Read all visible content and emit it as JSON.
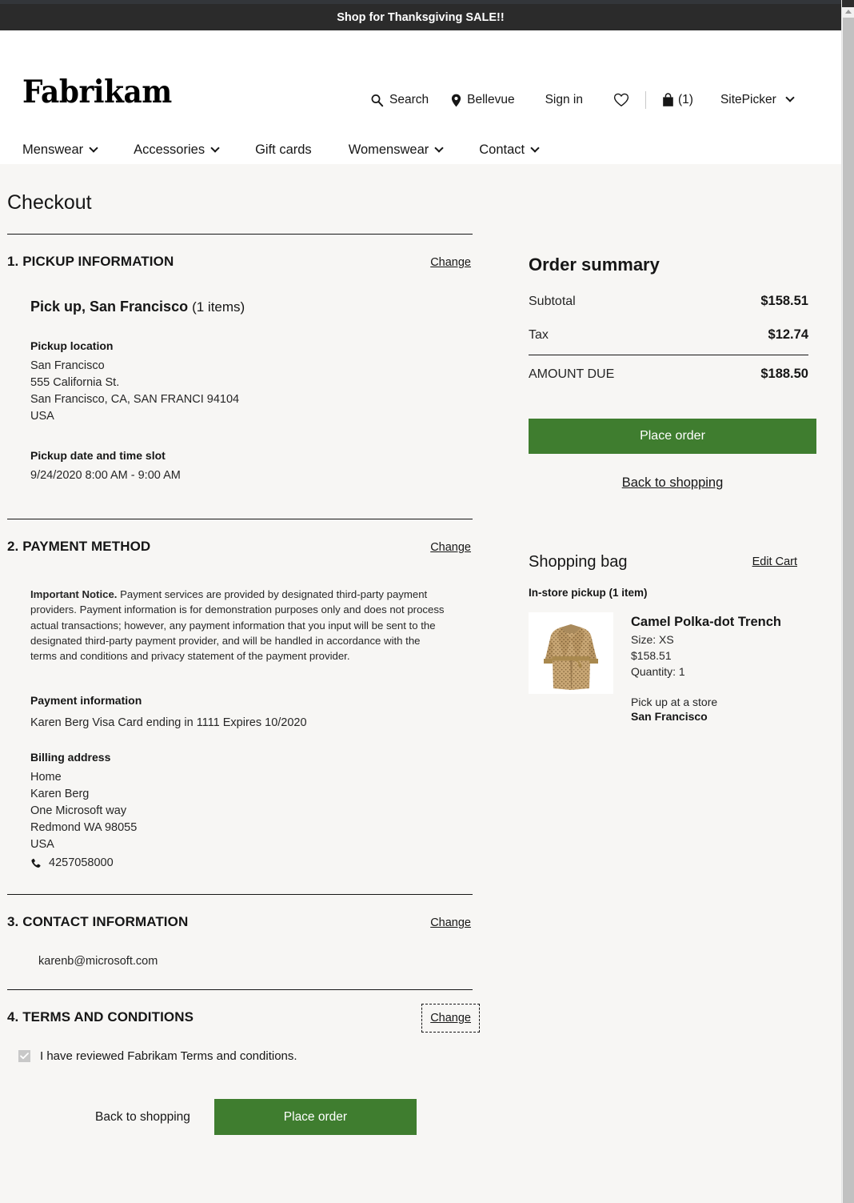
{
  "promo": {
    "text": "Shop for Thanksgiving SALE!!"
  },
  "header": {
    "logo": "Fabrikam",
    "utils": [
      {
        "label": "Search",
        "icon": "search-icon"
      },
      {
        "label": "Bellevue",
        "icon": "location-pin-icon"
      },
      {
        "label": "Sign in",
        "icon": ""
      },
      {
        "label": "",
        "icon": "heart-icon"
      },
      {
        "label": "(1)",
        "icon": "shopping-bag-icon"
      },
      {
        "label": "SitePicker",
        "icon": "chevron-down-icon"
      }
    ],
    "nav": [
      {
        "label": "Menswear",
        "has_chevron": true
      },
      {
        "label": "Accessories",
        "has_chevron": true
      },
      {
        "label": "Gift cards",
        "has_chevron": false
      },
      {
        "label": "Womenswear",
        "has_chevron": true
      },
      {
        "label": "Contact",
        "has_chevron": true
      }
    ]
  },
  "checkout": {
    "title": "Checkout",
    "change_label": "Change",
    "sections": {
      "pickup": {
        "number_title": "1. PICKUP INFORMATION",
        "heading_bold": "Pick up, San Francisco",
        "heading_count": "(1 items)",
        "location_label": "Pickup location",
        "location_lines": [
          "San Francisco",
          "555 California St.",
          "San Francisco, CA, SAN FRANCI 94104",
          "USA"
        ],
        "slot_label": "Pickup date and time slot",
        "slot_value": "9/24/2020 8:00 AM - 9:00 AM"
      },
      "payment": {
        "number_title": "2. PAYMENT METHOD",
        "notice_bold": "Important Notice.",
        "notice_text": "  Payment services are provided by designated third-party payment providers.  Payment information is for demonstration purposes only and does not process actual transactions; however, any payment information that you input will be sent to the designated third-party payment provider, and will be handled in accordance with the terms and conditions and privacy statement of the payment provider.",
        "info_label": "Payment information",
        "info_value": "Karen Berg   Visa   Card ending in 1111   Expires 10/2020",
        "billing_label": "Billing address",
        "billing_lines": [
          "Home",
          "Karen Berg",
          "One Microsoft way",
          "Redmond WA  98055",
          "USA"
        ],
        "phone": "4257058000"
      },
      "contact": {
        "number_title": "3. CONTACT INFORMATION",
        "email": "karenb@microsoft.com"
      },
      "terms": {
        "number_title": "4. TERMS AND CONDITIONS",
        "checkbox_label": "I have reviewed Fabrikam Terms and conditions.",
        "checkbox_checked": true,
        "change_focused": true
      }
    },
    "actions": {
      "back_to_shopping": "Back to shopping",
      "place_order": "Place order"
    }
  },
  "order_summary": {
    "title": "Order summary",
    "rows": [
      {
        "label": "Subtotal",
        "amount": "$158.51"
      },
      {
        "label": "Tax",
        "amount": "$12.74"
      }
    ],
    "total_label": "AMOUNT DUE",
    "total_amount": "$188.50",
    "place_order": "Place order",
    "back_to_shopping": "Back to shopping"
  },
  "shopping_bag": {
    "title": "Shopping bag",
    "edit_cart": "Edit Cart",
    "group_label": "In-store pickup (1 item)",
    "item": {
      "name": "Camel Polka-dot Trench",
      "size": "Size: XS",
      "price": "$158.51",
      "quantity": "Quantity: 1",
      "pickup_note": "Pick up at a store",
      "pickup_store": "San Francisco",
      "image_alt": "camel-polka-dot-trench-coat-image"
    }
  },
  "colors": {
    "accent_green": "#3f7d2f",
    "banner_dark": "#2b2b2b",
    "page_bg": "#f7f6f4"
  }
}
